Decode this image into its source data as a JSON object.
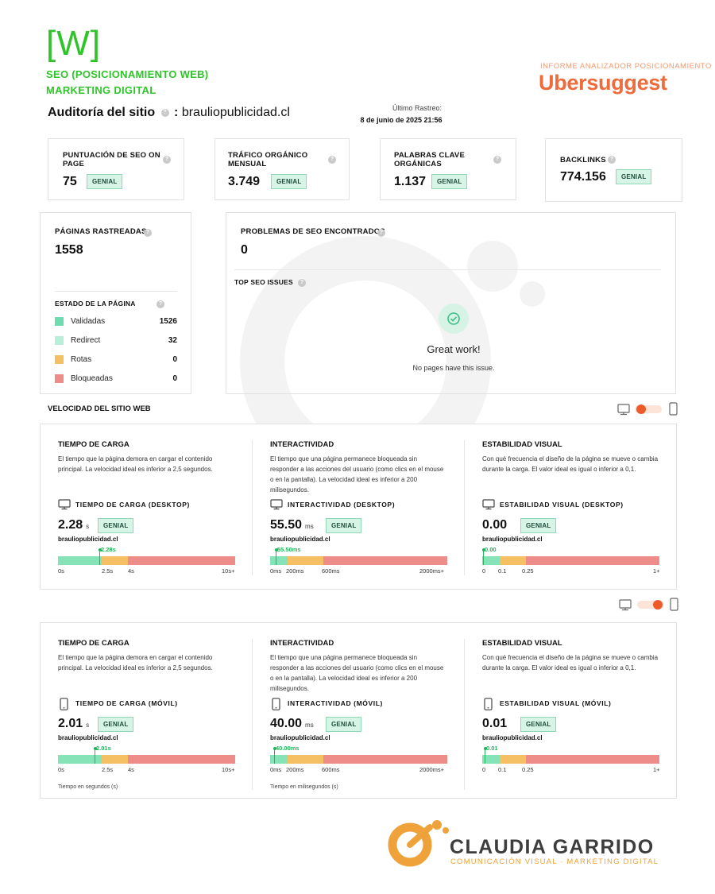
{
  "header": {
    "logo_mark": "[W]",
    "logo_line1": "SEO (POSICIONAMIENTO WEB)",
    "logo_line2": "MARKETING DIGITAL",
    "report_caption": "INFORME ANALIZADOR POSICIONAMIENTO",
    "brand": "Ubersuggest",
    "audit_label": "Auditoría del sitio",
    "audit_sep": ":",
    "audit_domain": "brauliopublicidad.cl",
    "last_crawl_label": "Último Rastreo:",
    "last_crawl_value": "8 de junio de 2025 21:56"
  },
  "kpis": [
    {
      "label": "PUNTUACIÓN DE SEO ON PAGE",
      "value": "75",
      "badge": "GENIAL"
    },
    {
      "label": "TRÁFICO ORGÁNICO MENSUAL",
      "value": "3.749",
      "badge": "GENIAL"
    },
    {
      "label": "PALABRAS CLAVE ORGÁNICAS",
      "value": "1.137",
      "badge": "GENIAL"
    },
    {
      "label": "BACKLINKS",
      "value": "774.156",
      "badge": "GENIAL"
    }
  ],
  "pages": {
    "label": "PÁGINAS RASTREADAS",
    "value": "1558",
    "status_label": "ESTADO DE LA PÁGINA",
    "legend": [
      {
        "label": "Validadas",
        "count": "1526",
        "color": "#6fdcb0"
      },
      {
        "label": "Redirect",
        "count": "32",
        "color": "#b9eed8"
      },
      {
        "label": "Rotas",
        "count": "0",
        "color": "#f5c063"
      },
      {
        "label": "Bloqueadas",
        "count": "0",
        "color": "#ee8c8a"
      }
    ]
  },
  "issues": {
    "label": "PROBLEMAS DE SEO ENCONTRADOS",
    "value": "0",
    "top_label": "TOP SEO ISSUES",
    "great": "Great work!",
    "none": "No pages have this issue."
  },
  "speed": {
    "title": "VELOCIDAD DEL SITIO WEB",
    "domain": "brauliopublicidad.cl",
    "columns": [
      {
        "title": "TIEMPO DE CARGA",
        "desc": "El tiempo que la página demora en cargar el contenido principal. La velocidad ideal es inferior a 2,5 segundos."
      },
      {
        "title": "INTERACTIVIDAD",
        "desc": "El tiempo que una página permanece bloqueada sin responder a las acciones del usuario (como clics en el mouse o en la pantalla). La velocidad ideal es inferior a 200 milisegundos."
      },
      {
        "title": "ESTABILIDAD VISUAL",
        "desc": "Con qué frecuencia el diseño de la página se mueve o cambia durante la carga. El valor ideal es igual o inferior a 0,1."
      }
    ],
    "desktop": [
      {
        "metric": "TIEMPO DE CARGA (DESKTOP)",
        "value": "2.28",
        "unit": "s",
        "badge": "GENIAL",
        "marker": "2.28s",
        "ticks": [
          "0s",
          "2.5s",
          "4s",
          "10s+"
        ],
        "level": 0.228
      },
      {
        "metric": "INTERACTIVIDAD (DESKTOP)",
        "value": "55.50",
        "unit": "ms",
        "badge": "GENIAL",
        "marker": "55.50ms",
        "ticks": [
          "0ms",
          "200ms",
          "600ms",
          "2000ms+"
        ],
        "level": 0.028
      },
      {
        "metric": "ESTABILIDAD VISUAL (DESKTOP)",
        "value": "0.00",
        "unit": "",
        "badge": "GENIAL",
        "marker": "0.00",
        "ticks": [
          "0",
          "0.1",
          "0.25",
          "1+"
        ],
        "level": 0.0
      }
    ],
    "mobile": [
      {
        "metric": "TIEMPO DE CARGA (MÓVIL)",
        "value": "2.01",
        "unit": "s",
        "badge": "GENIAL",
        "marker": "2.01s",
        "ticks": [
          "0s",
          "2.5s",
          "4s",
          "10s+"
        ],
        "level": 0.201
      },
      {
        "metric": "INTERACTIVIDAD (MÓVIL)",
        "value": "40.00",
        "unit": "ms",
        "badge": "GENIAL",
        "marker": "40.00ms",
        "ticks": [
          "0ms",
          "200ms",
          "600ms",
          "2000ms+"
        ],
        "level": 0.02
      },
      {
        "metric": "ESTABILIDAD VISUAL (MÓVIL)",
        "value": "0.01",
        "unit": "",
        "badge": "GENIAL",
        "marker": "0.01",
        "ticks": [
          "0",
          "0.1",
          "0.25",
          "1+"
        ],
        "level": 0.01
      }
    ],
    "footnote_seconds": "Tiempo en segundos (s)",
    "footnote_ms": "Tiempo en milisegundos (s)"
  },
  "footer": {
    "name": "CLAUDIA GARRIDO",
    "tagline": "COMUNICACIÓN VISUAL · MARKETING DIGITAL"
  },
  "colors": {
    "good": "#86e3b8",
    "warn": "#f5c063",
    "bad": "#ee8c8a",
    "brand": "#ee6b3c",
    "logo_green": "#2fc42a"
  },
  "icons": [
    "help-icon",
    "desktop-icon",
    "mobile-icon",
    "check-icon",
    "toggle-switch"
  ]
}
